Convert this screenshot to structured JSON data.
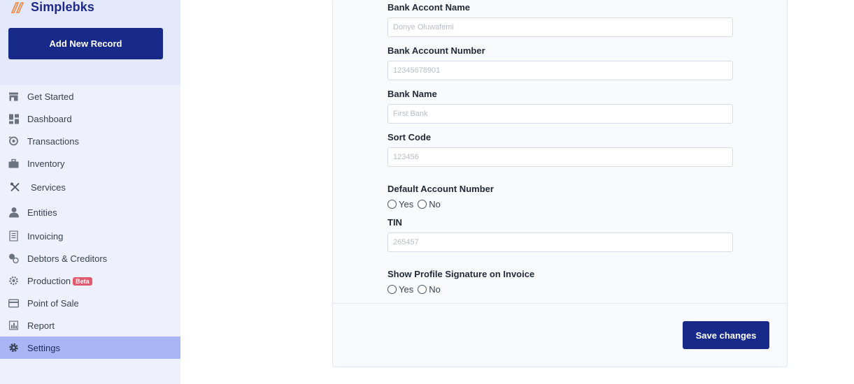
{
  "brand": {
    "name": "Simplebks",
    "color": "#1e2a86",
    "accent": "#f0883e"
  },
  "sidebar": {
    "add_button": "Add New Record",
    "items": [
      {
        "label": "Get Started",
        "icon": "store-icon"
      },
      {
        "label": "Dashboard",
        "icon": "dashboard-icon"
      },
      {
        "label": "Transactions",
        "icon": "transactions-icon"
      },
      {
        "label": "Inventory",
        "icon": "briefcase-icon"
      },
      {
        "label": "Services",
        "icon": "tools-icon"
      },
      {
        "label": "Entities",
        "icon": "person-icon"
      },
      {
        "label": "Invoicing",
        "icon": "receipt-icon"
      },
      {
        "label": "Debtors & Creditors",
        "icon": "debtors-icon"
      },
      {
        "label": "Production",
        "icon": "production-icon",
        "badge": "Beta"
      },
      {
        "label": "Point of Sale",
        "icon": "card-icon"
      },
      {
        "label": "Report",
        "icon": "chart-icon"
      },
      {
        "label": "Settings",
        "icon": "gear-icon",
        "active": true
      }
    ],
    "active_color": "#aab5f6"
  },
  "form": {
    "bank_account_name": {
      "label": "Bank Accont Name",
      "placeholder": "Donye Oluwafemi"
    },
    "bank_account_number": {
      "label": "Bank Account Number",
      "placeholder": "12345678901"
    },
    "bank_name": {
      "label": "Bank Name",
      "placeholder": "First Bank"
    },
    "sort_code": {
      "label": "Sort Code",
      "placeholder": "123456"
    },
    "default_account": {
      "label": "Default Account Number",
      "yes": "Yes",
      "no": "No"
    },
    "tin": {
      "label": "TIN",
      "placeholder": "265457"
    },
    "show_signature": {
      "label": "Show Profile Signature on Invoice",
      "yes": "Yes",
      "no": "No"
    },
    "save_button": "Save changes"
  }
}
